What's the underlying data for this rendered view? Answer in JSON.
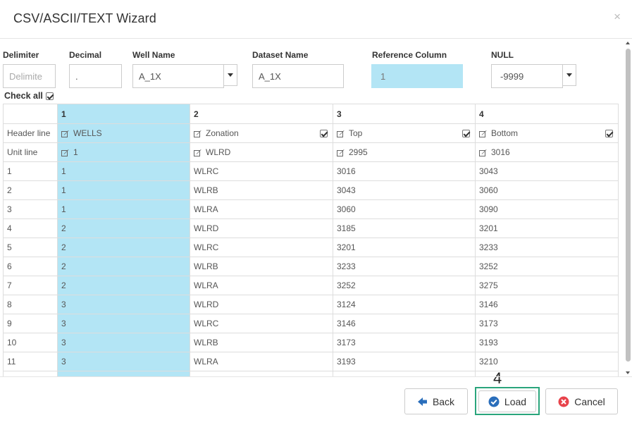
{
  "dialog": {
    "title": "CSV/ASCII/TEXT Wizard",
    "close_label": "×"
  },
  "fields": {
    "delimiter": {
      "label": "Delimiter",
      "placeholder": "Delimite"
    },
    "decimal": {
      "label": "Decimal",
      "value": "."
    },
    "well_name": {
      "label": "Well Name",
      "value": "A_1X"
    },
    "dataset_name": {
      "label": "Dataset Name",
      "value": "A_1X"
    },
    "reference_column": {
      "label": "Reference Column",
      "value": "1"
    },
    "null": {
      "label": "NULL",
      "value": "-9999"
    }
  },
  "check_all": {
    "label": "Check all",
    "checked": true
  },
  "table": {
    "columns": [
      "1",
      "2",
      "3",
      "4"
    ],
    "header_line": {
      "label": "Header line",
      "values": [
        "WELLS",
        "Zonation",
        "Top",
        "Bottom"
      ]
    },
    "unit_line": {
      "label": "Unit line",
      "values": [
        "1",
        "WLRD",
        "2995",
        "3016"
      ]
    },
    "rows": [
      {
        "index": "1",
        "cells": [
          "1",
          "WLRC",
          "3016",
          "3043"
        ]
      },
      {
        "index": "2",
        "cells": [
          "1",
          "WLRB",
          "3043",
          "3060"
        ]
      },
      {
        "index": "3",
        "cells": [
          "1",
          "WLRA",
          "3060",
          "3090"
        ]
      },
      {
        "index": "4",
        "cells": [
          "2",
          "WLRD",
          "3185",
          "3201"
        ]
      },
      {
        "index": "5",
        "cells": [
          "2",
          "WLRC",
          "3201",
          "3233"
        ]
      },
      {
        "index": "6",
        "cells": [
          "2",
          "WLRB",
          "3233",
          "3252"
        ]
      },
      {
        "index": "7",
        "cells": [
          "2",
          "WLRA",
          "3252",
          "3275"
        ]
      },
      {
        "index": "8",
        "cells": [
          "3",
          "WLRD",
          "3124",
          "3146"
        ]
      },
      {
        "index": "9",
        "cells": [
          "3",
          "WLRC",
          "3146",
          "3173"
        ]
      },
      {
        "index": "10",
        "cells": [
          "3",
          "WLRB",
          "3173",
          "3193"
        ]
      },
      {
        "index": "11",
        "cells": [
          "3",
          "WLRA",
          "3193",
          "3210"
        ]
      }
    ],
    "selected_column": "1"
  },
  "footer": {
    "step_marker": "4",
    "back_label": "Back",
    "load_label": "Load",
    "cancel_label": "Cancel"
  },
  "icons": {
    "back": "arrow-left-icon",
    "load": "check-circle-icon",
    "cancel": "x-circle-icon",
    "edit": "edit-icon"
  },
  "colors": {
    "selected_column_bg": "#b3e5f5",
    "load_icon": "#2a6ebb",
    "back_icon": "#2a6ebb",
    "cancel_icon": "#e8434b",
    "highlight_frame": "#2aa57c"
  }
}
